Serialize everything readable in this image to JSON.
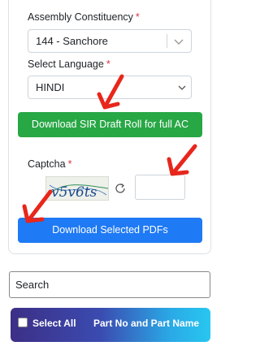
{
  "form": {
    "assembly_label": "Assembly Constituency",
    "assembly_value": "144 - Sanchore",
    "language_label": "Select Language",
    "language_value": "HINDI",
    "required_mark": "*",
    "download_full_label": "Download SIR Draft Roll for full AC",
    "captcha_label": "Captcha",
    "captcha_text": "v5v6ts",
    "captcha_input_value": "",
    "download_selected_label": "Download Selected PDFs"
  },
  "search": {
    "placeholder": "Search"
  },
  "table": {
    "select_all_label": "Select All",
    "part_header": "Part No and Part Name"
  },
  "icons": {
    "refresh": "refresh-icon",
    "chevron": "chevron-down-icon",
    "annotation": "red-arrow"
  },
  "colors": {
    "green_button": "#28a745",
    "blue_button": "#1f7af5",
    "required": "#dc3545",
    "annotation_arrow": "#e8261c"
  }
}
